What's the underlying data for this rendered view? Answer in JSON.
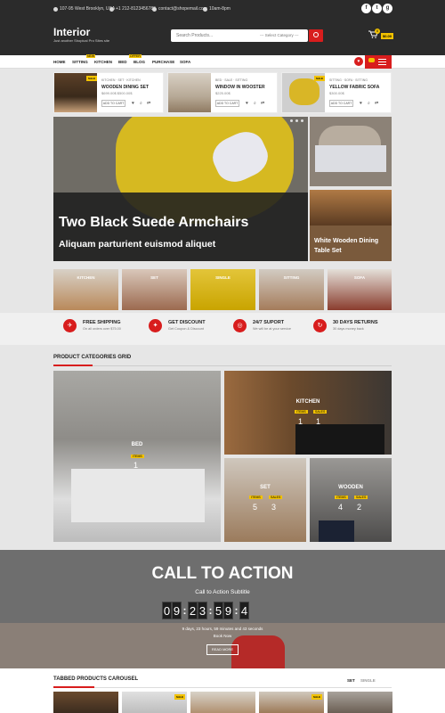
{
  "topbar": {
    "address": "107-95 West Brooklyn, USA",
    "phone": "+1 212-8123456789",
    "email": "contact@shopemail.com",
    "hours": "10am-8pm",
    "social": [
      "f",
      "t",
      "g"
    ]
  },
  "header": {
    "logo": "Interior",
    "tagline": "Just another Shopical Pro Sites site",
    "search_placeholder": "Search Products...",
    "category_select": "--- Select Category ---",
    "cart_count": "0",
    "cart_total": "$0.00"
  },
  "nav": {
    "items": [
      "HOME",
      "SITTING",
      "KITCHEN",
      "BED",
      "BLOG",
      "PURCHASE",
      "SOFA"
    ],
    "tags": {
      "new": "NEW",
      "offer": "OFFER"
    }
  },
  "products": [
    {
      "category": "KITCHEN · SET · KITCHEN",
      "name": "WOODEN DINING SET",
      "price": "$699.00$  $500.00$",
      "add": "ADD TO CART",
      "sale": "SALE"
    },
    {
      "category": "BED · SALE · SITTING",
      "name": "WINDOW IN WOOSTER",
      "price": "$225.00$",
      "add": "ADD TO CART",
      "sale": ""
    },
    {
      "category": "SITTING · SOFA · SITTING",
      "name": "YELLOW FABRIC SOFA",
      "price": "$300.00$",
      "add": "ADD TO CART",
      "sale": "SALE"
    }
  ],
  "slider": {
    "title": "Two Black Suede Armchairs",
    "subtitle": "Aliquam parturient euismod aliquet"
  },
  "side_banner": {
    "title": "White Wooden Dining Table Set"
  },
  "category_strip": [
    "KITCHEN",
    "SET",
    "SINGLE",
    "SITTING",
    "SOFA"
  ],
  "features": [
    {
      "title": "FREE SHIPPING",
      "sub": "On all orders over $75.00",
      "icon": "ship-icon"
    },
    {
      "title": "GET DISCOUNT",
      "sub": "Get Coupon & Discount",
      "icon": "gift-icon"
    },
    {
      "title": "24/7 SUPORT",
      "sub": "We will be at your service",
      "icon": "support-icon"
    },
    {
      "title": "30 DAYS RETURNS",
      "sub": "30 days money back",
      "icon": "return-icon"
    }
  ],
  "grid": {
    "title": "PRODUCT CATEGORIES GRID",
    "items": [
      {
        "name": "BED",
        "items_label": "ITEMS",
        "sales_label": "",
        "items": "1",
        "sales": ""
      },
      {
        "name": "KITCHEN",
        "items_label": "ITEMS",
        "sales_label": "SALES",
        "items": "1",
        "sales": "1"
      },
      {
        "name": "SET",
        "items_label": "ITEMS",
        "sales_label": "SALES",
        "items": "5",
        "sales": "3"
      },
      {
        "name": "WOODEN",
        "items_label": "ITEMS",
        "sales_label": "SALES",
        "items": "4",
        "sales": "2"
      }
    ]
  },
  "cta": {
    "title": "CALL TO ACTION",
    "subtitle": "Call to Action Subtitle",
    "countdown": [
      "0",
      "9",
      "2",
      "3",
      "5",
      "9",
      "4"
    ],
    "remaining": "9 days, 23 hours, 59 minutes and 43 seconds",
    "book": "Book Now",
    "button": "READ MORE"
  },
  "tabbed": {
    "title": "TABBED PRODUCTS CAROUSEL",
    "tabs": [
      "SET",
      "SINGLE"
    ],
    "sale": "SALE"
  },
  "colors": {
    "accent": "#d81d1d",
    "yellow": "#f2c200",
    "dark": "#2b2b2b"
  }
}
